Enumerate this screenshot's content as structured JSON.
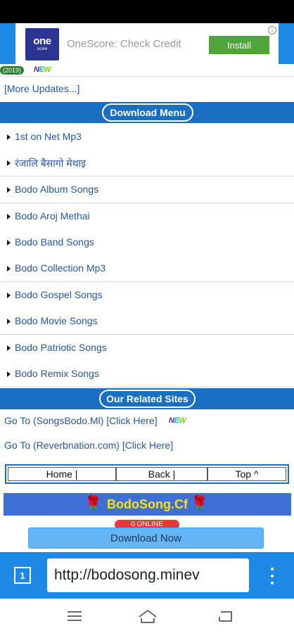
{
  "ad": {
    "logo_main": "one",
    "logo_sub": "score",
    "title": "OneScore: Check Credit",
    "install_label": "Install",
    "info_glyph": "i"
  },
  "marquee": {
    "year": "(2019)",
    "new_badge": [
      "N",
      "E",
      "W"
    ]
  },
  "more_updates": "[More Updates...]",
  "download_menu": {
    "title": "Download Menu",
    "items": [
      "1st on Net Mp3",
      "रंजालि बैसागो मेथाइ",
      "Bodo Album Songs",
      "Bodo Aroj Methai",
      "Bodo Band Songs",
      "Bodo Collection Mp3",
      "Bodo Gospel Songs",
      "Bodo Movie Songs",
      "Bodo Patriotic Songs",
      "Bodo Remix Songs"
    ]
  },
  "related": {
    "title": "Our Related Sites",
    "links": [
      "Go To (SongsBodo.Ml) [Click Here]",
      "Go To (Reverbnation.com) [Click Here]"
    ]
  },
  "nav": {
    "home": "Home |",
    "back": "Back |",
    "top": "Top ^"
  },
  "brand": {
    "title": "BodoSong.Cf",
    "rose_glyph": "🌹"
  },
  "online_badge": "0 ONLINE",
  "download_now": "Download Now",
  "browser": {
    "tab_count": "1",
    "url": "http://bodosong.minev"
  },
  "colors": {
    "accent": "#1b6fc2",
    "link": "#2457a4",
    "brand_yellow": "#ffe100",
    "install_green": "#51a33c"
  }
}
